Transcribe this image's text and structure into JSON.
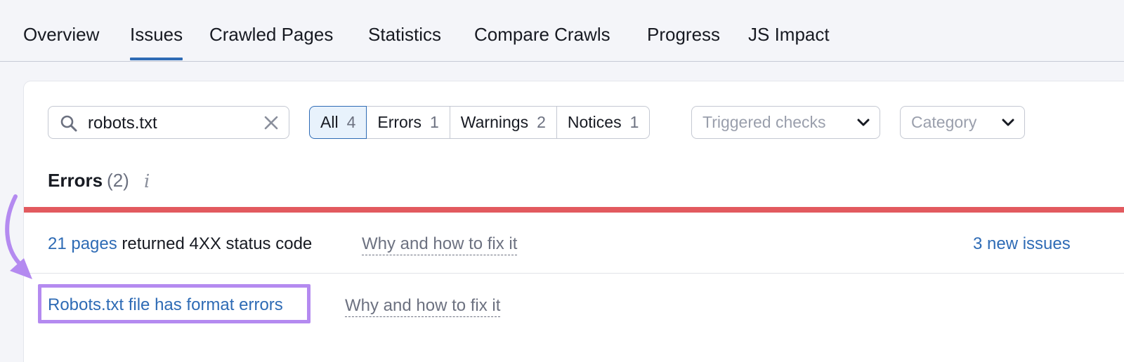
{
  "tabs": [
    "Overview",
    "Issues",
    "Crawled Pages",
    "Statistics",
    "Compare Crawls",
    "Progress",
    "JS Impact"
  ],
  "search": {
    "value": "robots.txt"
  },
  "filters": [
    {
      "label": "All",
      "count": "4"
    },
    {
      "label": "Errors",
      "count": "1"
    },
    {
      "label": "Warnings",
      "count": "2"
    },
    {
      "label": "Notices",
      "count": "1"
    }
  ],
  "dropdowns": {
    "triggered": "Triggered checks",
    "category": "Category"
  },
  "errors": {
    "title": "Errors",
    "count": "(2)",
    "info": "i"
  },
  "rows": [
    {
      "link": "21 pages",
      "text": " returned 4XX status code",
      "help": "Why and how to fix it",
      "new_issues": "3 new issues"
    },
    {
      "link": "Robots.txt file has format errors",
      "help": "Why and how to fix it"
    }
  ],
  "colors": {
    "accent": "#2e6bb5",
    "error_bar": "#e25a5f",
    "highlight": "#b48af0"
  },
  "icons": {
    "search": "search-icon",
    "clear": "close-icon",
    "dropdown": "chevron-down-icon",
    "info": "info-icon",
    "annotation": "curved-arrow-icon"
  }
}
